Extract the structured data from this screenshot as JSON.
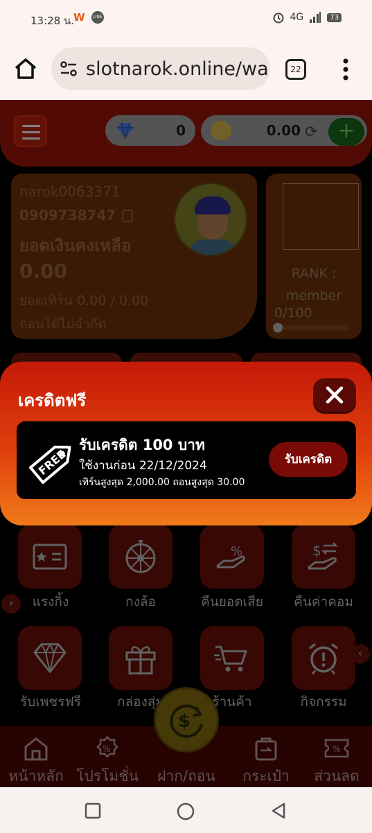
{
  "status_bar": {
    "time": "13:28 น.",
    "network": "4G",
    "battery": "73",
    "line_label": "LINE",
    "w_label": "W"
  },
  "browser": {
    "url": "slotnarok.online/wa",
    "tab_count": "22"
  },
  "wallet": {
    "diamonds": "0",
    "credit": "0.00",
    "plus": "+"
  },
  "user": {
    "username": "narok0063371",
    "phone": "0909738747",
    "balance_label": "ยอดเงินคงเหลือ",
    "balance": "0.00",
    "turnover": "ยอดเทิร์น 0.00 / 0.00",
    "withdraw": "ถอนได้ไม่จำกัด"
  },
  "rank": {
    "label": "RANK :",
    "level": "member",
    "progress_text": "0/100",
    "progress": 0
  },
  "grid": [
    {
      "label": "แรงกิ้ง",
      "icon": "id-card-icon"
    },
    {
      "label": "กงล้อ",
      "icon": "wheel-icon"
    },
    {
      "label": "คืนยอดเสีย",
      "icon": "cashback-icon"
    },
    {
      "label": "คืนค่าคอม",
      "icon": "commission-icon"
    },
    {
      "label": "รับเพชรฟรี",
      "icon": "diamond-icon"
    },
    {
      "label": "กล่องสุ่ม",
      "icon": "gift-icon"
    },
    {
      "label": "ร้านค้า",
      "icon": "cart-icon"
    },
    {
      "label": "กิจกรรม",
      "icon": "alarm-icon"
    }
  ],
  "bottom_nav": [
    {
      "label": "หน้าหลัก"
    },
    {
      "label": "โปรโมชั่น"
    },
    {
      "label": "ฝาก/ถอน"
    },
    {
      "label": "กระเป๋า"
    },
    {
      "label": "ส่วนลด"
    }
  ],
  "modal": {
    "title": "เครดิตฟรี",
    "close": "✕",
    "coupon": {
      "tag_text": "FREE",
      "title": "รับเครดิต 100 บาท",
      "expiry": "ใช้งานก่อน 22/12/2024",
      "limits": "เทิร์นสูงสุด 2,000.00 ถอนสูงสุด 30.00",
      "claim_label": "รับเครดิต"
    }
  }
}
